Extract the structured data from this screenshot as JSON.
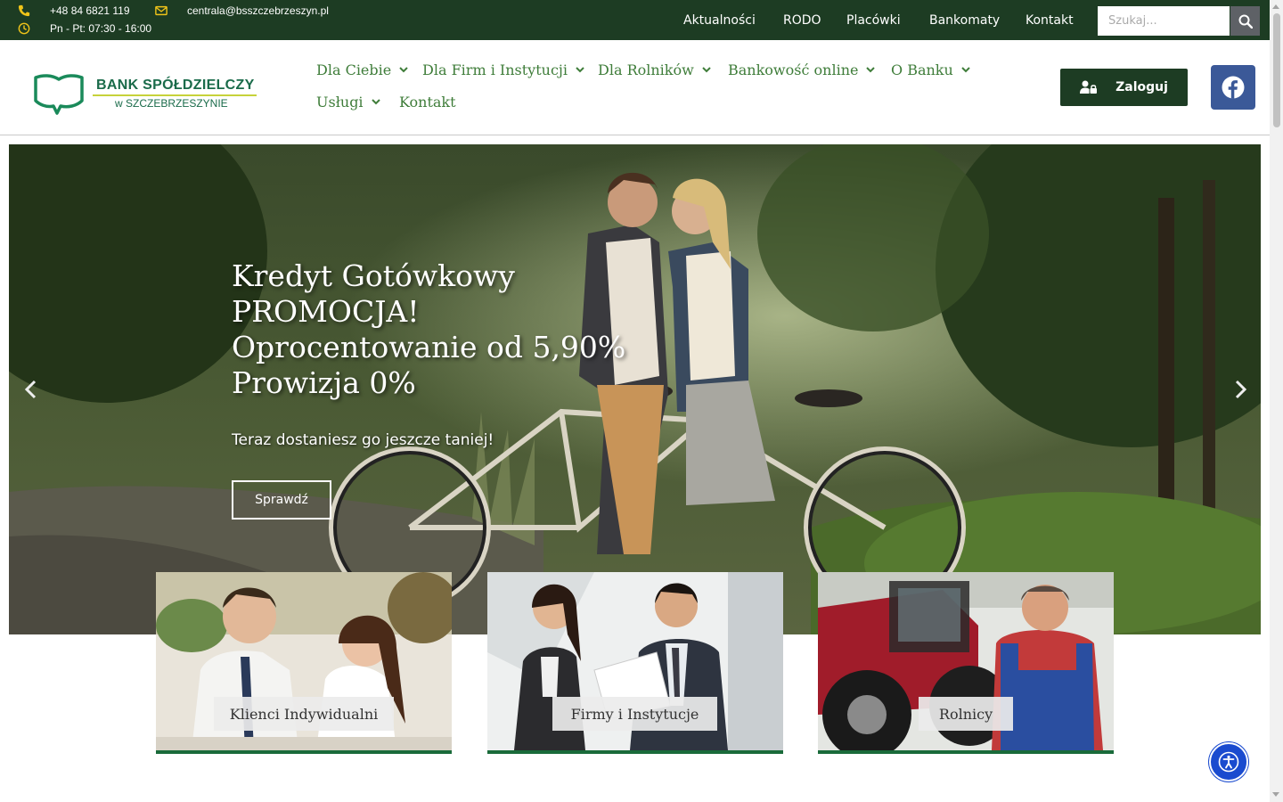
{
  "topbar": {
    "phone": "+48 84 6821 119",
    "email": "centrala@bsszczebrzeszyn.pl",
    "hours": "Pn - Pt: 07:30 - 16:00",
    "nav": [
      "Aktualności",
      "RODO",
      "Placówki",
      "Bankomaty",
      "Kontakt"
    ],
    "search_placeholder": "Szukaj..."
  },
  "logo": {
    "line1": "BANK SPÓŁDZIELCZY",
    "line2": "w SZCZEBRZESZYNIE"
  },
  "mainnav": {
    "items": [
      {
        "label": "Dla Ciebie"
      },
      {
        "label": "Dla Firm i Instytucji"
      },
      {
        "label": "Dla Rolników"
      },
      {
        "label": "Bankowość online"
      },
      {
        "label": "O Banku"
      },
      {
        "label": "Usługi"
      },
      {
        "label": "Kontakt"
      }
    ]
  },
  "header": {
    "login_label": "Zaloguj"
  },
  "hero": {
    "title_lines": [
      "Kredyt Gotówkowy",
      "PROMOCJA!",
      "Oprocentowanie od 5,90%",
      "Prowizja 0%"
    ],
    "subtitle": "Teraz dostaniesz go jeszcze taniej!",
    "button": "Sprawdź"
  },
  "cards": [
    {
      "label": "Klienci Indywidualni"
    },
    {
      "label": "Firmy i Instytucje"
    },
    {
      "label": "Rolnicy"
    }
  ],
  "colors": {
    "topbar_bg": "#1d3c23",
    "nav_green": "#3f7d3a",
    "accent_yellow": "#f0c419",
    "facebook": "#3b5998",
    "card_border": "#1a6b3a",
    "accessibility": "#1a4bcf"
  }
}
